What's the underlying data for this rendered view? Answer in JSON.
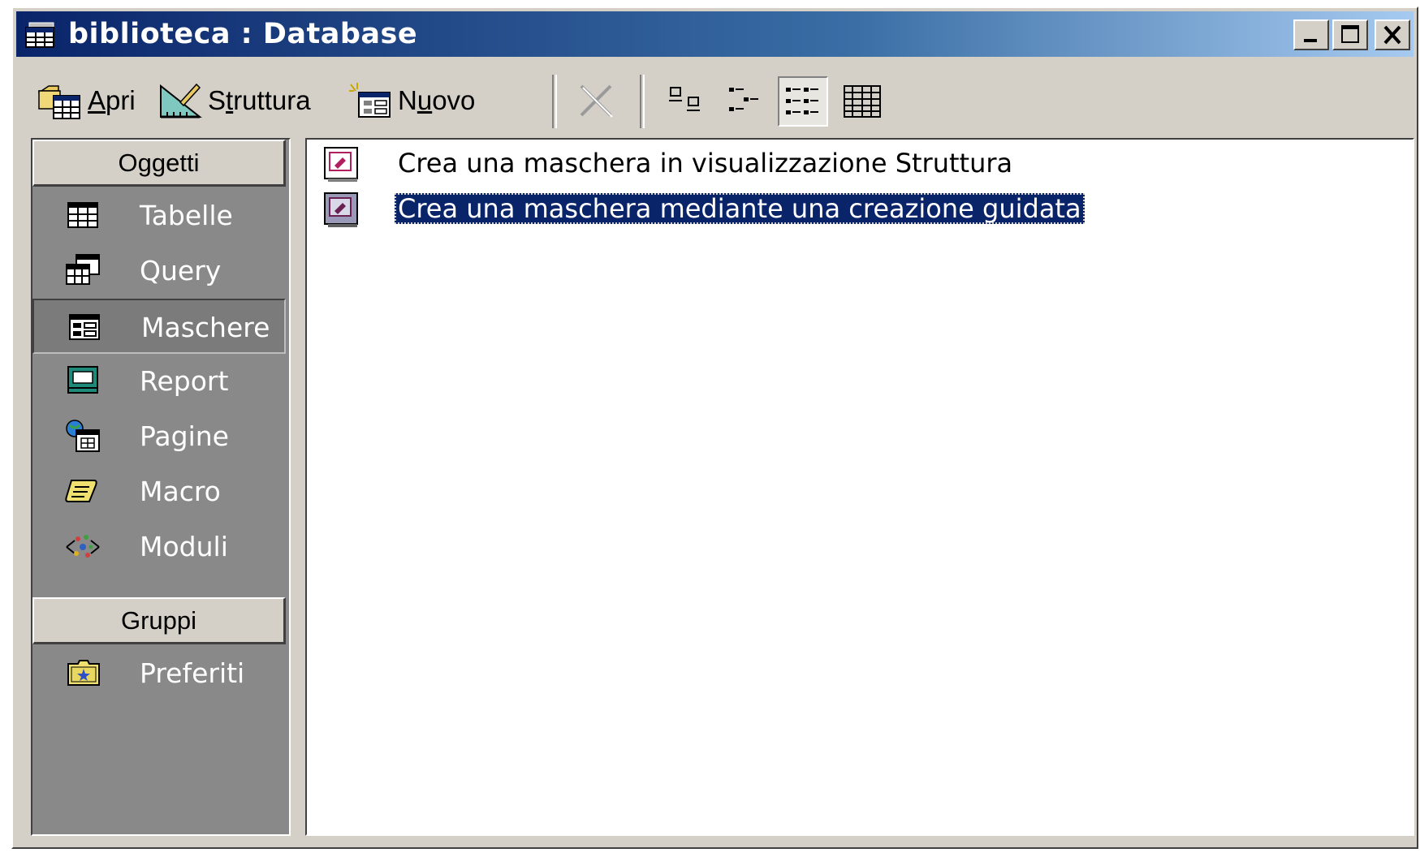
{
  "window": {
    "title": "biblioteca : Database",
    "icon": "database-window-icon",
    "controls": [
      "minimize-icon",
      "maximize-icon",
      "close-icon"
    ]
  },
  "toolbar": {
    "buttons": [
      {
        "label": "Apri",
        "icon": "open-icon"
      },
      {
        "label": "Struttura",
        "icon": "design-icon"
      },
      {
        "label": "Nuovo",
        "icon": "new-icon"
      }
    ],
    "delete_icon": "delete-icon",
    "view_icons": [
      "large-icons-view-icon",
      "small-icons-view-icon",
      "list-view-icon",
      "details-view-icon"
    ],
    "active_view": "list"
  },
  "sidebar": {
    "objects_header": "Oggetti",
    "items": [
      {
        "label": "Tabelle",
        "icon": "table-icon"
      },
      {
        "label": "Query",
        "icon": "query-icon"
      },
      {
        "label": "Maschere",
        "icon": "form-icon",
        "selected": true
      },
      {
        "label": "Report",
        "icon": "report-icon"
      },
      {
        "label": "Pagine",
        "icon": "page-icon"
      },
      {
        "label": "Macro",
        "icon": "macro-icon"
      },
      {
        "label": "Moduli",
        "icon": "module-icon"
      }
    ],
    "groups_header": "Gruppi",
    "groups": [
      {
        "label": "Preferiti",
        "icon": "favorites-icon"
      }
    ]
  },
  "list": {
    "items": [
      {
        "text": "Crea una maschera in visualizzazione Struttura",
        "icon": "new-form-design-icon"
      },
      {
        "text": "Crea una maschera mediante una creazione guidata",
        "icon": "new-form-wizard-icon",
        "selected": true
      }
    ]
  },
  "colors": {
    "title_bar": "#0a246a",
    "selection": "#0a246a",
    "sidebar_bg": "#898989",
    "chrome": "#d4d0c8"
  }
}
